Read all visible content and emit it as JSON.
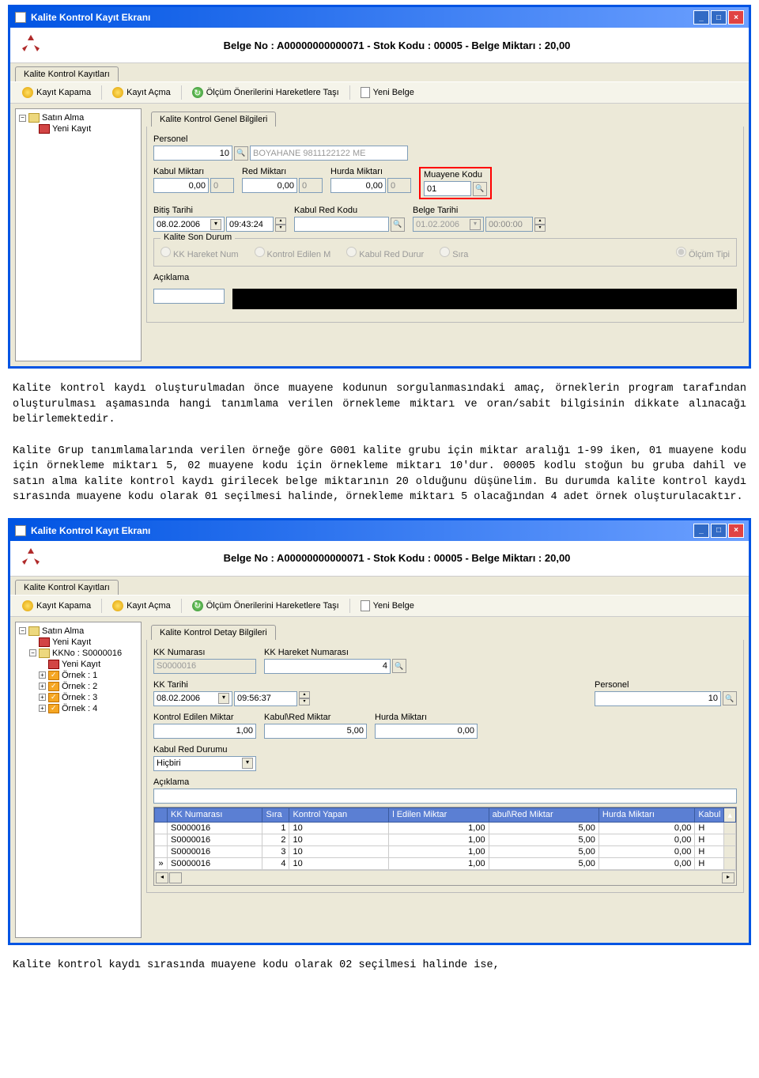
{
  "win1": {
    "title": "Kalite Kontrol Kayıt Ekranı",
    "header": "Belge No : A00000000000071 - Stok Kodu : 00005 - Belge Miktarı : 20,00",
    "tab": "Kalite Kontrol Kayıtları",
    "toolbar": {
      "b1": "Kayıt Kapama",
      "b2": "Kayıt Açma",
      "b3": "Ölçüm Önerilerini Hareketlere Taşı",
      "b4": "Yeni Belge"
    },
    "tree": {
      "n1": "Satın Alma",
      "n2": "Yeni Kayıt"
    },
    "group1": "Kalite Kontrol Genel Bilgileri",
    "l_personel": "Personel",
    "v_personel": "10",
    "v_personel_name": "BOYAHANE 9811122122 ME",
    "l_kabul": "Kabul Miktarı",
    "v_kabul": "0,00",
    "v_kabul2": "0",
    "l_red": "Red Miktarı",
    "v_red": "0,00",
    "v_red2": "0",
    "l_hurda": "Hurda Miktarı",
    "v_hurda": "0,00",
    "v_hurda2": "0",
    "l_muayene": "Muayene Kodu",
    "v_muayene": "01",
    "l_bitis": "Bitiş Tarihi",
    "v_bitis": "08.02.2006",
    "v_bitis_time": "09:43:24",
    "l_kabulred": "Kabul Red Kodu",
    "l_belgetarihi": "Belge Tarihi",
    "v_belgetarihi": "01.02.2006",
    "v_belgetarihi_time": "00:00:00",
    "group2": "Kalite Son Durum",
    "r1": "KK Hareket Num",
    "r2": "Kontrol Edilen M",
    "r3": "Kabul Red Durur",
    "r4": "Sıra",
    "r5": "Ölçüm Tipi",
    "l_aciklama": "Açıklama"
  },
  "prose1": "Kalite kontrol kaydı oluşturulmadan önce muayene kodunun sorgulanmasındaki amaç, örneklerin program tarafından oluşturulması aşamasında hangi tanımlama verilen örnekleme miktarı ve oran/sabit bilgisinin dikkate alınacağı belirlemektedir.",
  "prose2": "Kalite Grup tanımlamalarında verilen örneğe göre G001 kalite grubu için miktar aralığı 1-99 iken, 01 muayene kodu için örnekleme miktarı 5, 02 muayene kodu için örnekleme miktarı 10'dur. 00005 kodlu stoğun bu gruba dahil ve satın alma kalite kontrol kaydı girilecek belge miktarının 20 olduğunu düşünelim. Bu durumda kalite kontrol kaydı sırasında muayene kodu olarak 01 seçilmesi halinde, örnekleme miktarı 5 olacağından 4 adet örnek oluşturulacaktır.",
  "win2": {
    "title": "Kalite Kontrol Kayıt Ekranı",
    "header": "Belge No : A00000000000071 - Stok Kodu : 00005 - Belge Miktarı : 20,00",
    "tab": "Kalite Kontrol Kayıtları",
    "toolbar": {
      "b1": "Kayıt Kapama",
      "b2": "Kayıt Açma",
      "b3": "Ölçüm Önerilerini Hareketlere Taşı",
      "b4": "Yeni Belge"
    },
    "tree": {
      "n1": "Satın Alma",
      "n2": "Yeni Kayıt",
      "n3": "KKNo : S0000016",
      "n4": "Yeni Kayıt",
      "n5": "Örnek : 1",
      "n6": "Örnek : 2",
      "n7": "Örnek : 3",
      "n8": "Örnek : 4"
    },
    "group": "Kalite Kontrol Detay Bilgileri",
    "l_kknum": "KK Numarası",
    "v_kknum": "S0000016",
    "l_kkhar": "KK Hareket Numarası",
    "v_kkhar": "4",
    "l_kktarih": "KK Tarihi",
    "v_kktarih": "08.02.2006",
    "v_kktime": "09:56:37",
    "l_personel": "Personel",
    "v_personel": "10",
    "l_kedil": "Kontrol Edilen Miktar",
    "v_kedil": "1,00",
    "l_kabred": "Kabul\\Red Miktar",
    "v_kabred": "5,00",
    "l_hurda": "Hurda Miktarı",
    "v_hurda": "0,00",
    "l_krdurum": "Kabul Red Durumu",
    "v_krdurum": "Hiçbiri",
    "l_aciklama": "Açıklama",
    "thead": {
      "c1": "KK Numarası",
      "c2": "Sıra",
      "c3": "Kontrol Yapan",
      "c4": "l Edilen Miktar",
      "c5": "abul\\Red Miktar",
      "c6": "Hurda Miktarı",
      "c7": "Kabul"
    },
    "rows": [
      {
        "c1": "S0000016",
        "c2": "1",
        "c3": "10",
        "c4": "1,00",
        "c5": "5,00",
        "c6": "0,00",
        "c7": "H"
      },
      {
        "c1": "S0000016",
        "c2": "2",
        "c3": "10",
        "c4": "1,00",
        "c5": "5,00",
        "c6": "0,00",
        "c7": "H"
      },
      {
        "c1": "S0000016",
        "c2": "3",
        "c3": "10",
        "c4": "1,00",
        "c5": "5,00",
        "c6": "0,00",
        "c7": "H"
      },
      {
        "c1": "S0000016",
        "c2": "4",
        "c3": "10",
        "c4": "1,00",
        "c5": "5,00",
        "c6": "0,00",
        "c7": "H"
      }
    ]
  },
  "prose3": "Kalite kontrol kaydı sırasında muayene kodu olarak 02 seçilmesi halinde ise,"
}
